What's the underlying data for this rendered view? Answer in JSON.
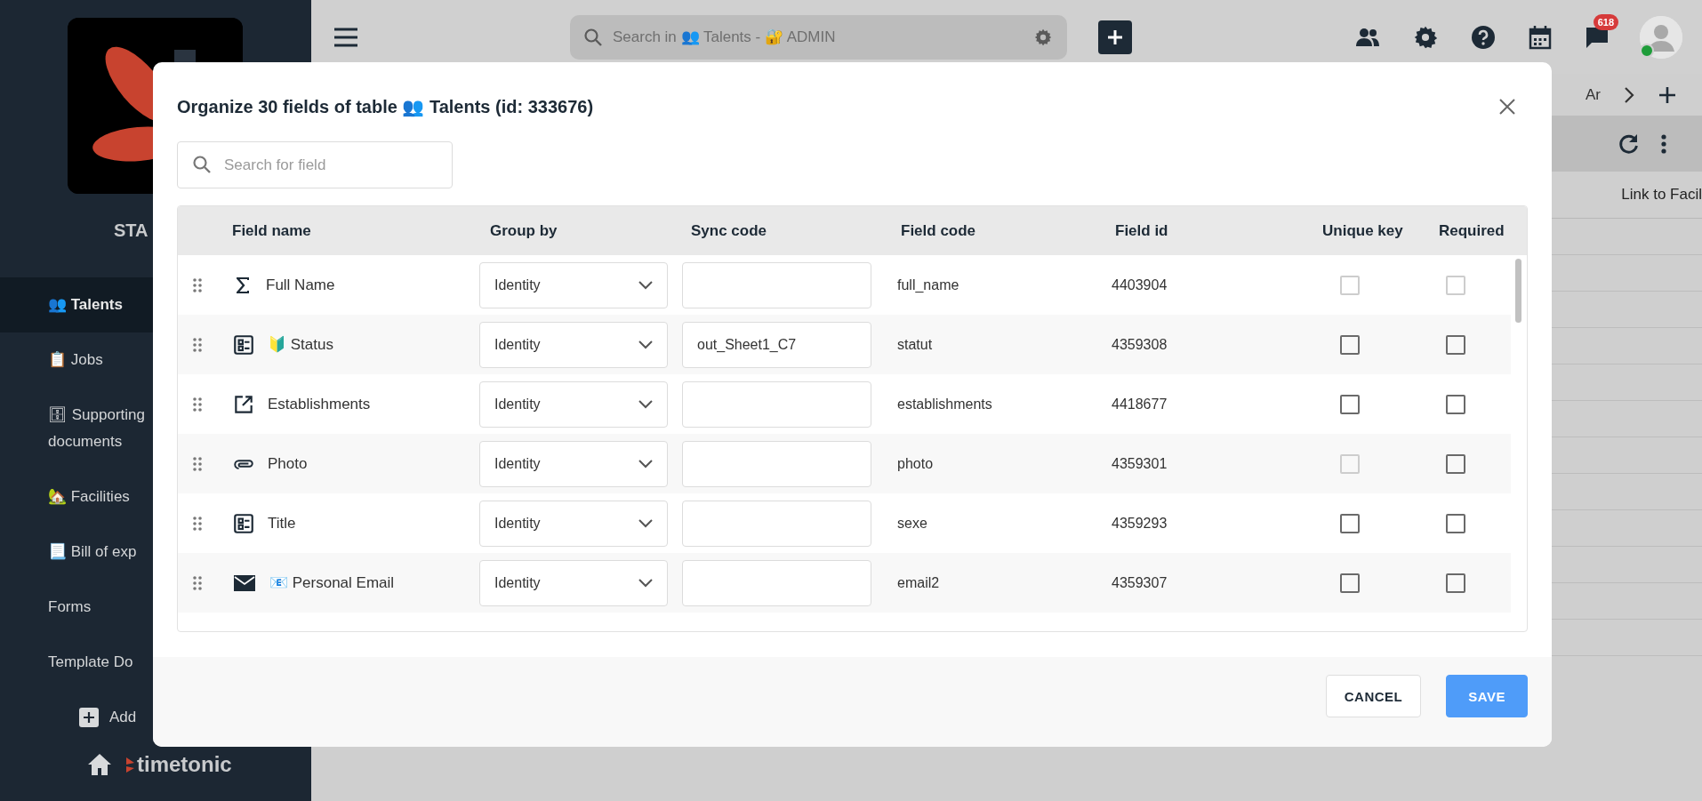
{
  "topbar": {
    "search_placeholder": "Search in 👥 Talents - 🔐 ADMIN",
    "notifications": "618",
    "user_online": true
  },
  "sidebar": {
    "workspace": "STA",
    "items": [
      {
        "label": "👥 Talents",
        "kind": "nav",
        "selected": true
      },
      {
        "label": "📋 Jobs",
        "kind": "nav",
        "selected": false
      },
      {
        "label": "🗄 Supporting documents",
        "kind": "nav",
        "selected": false
      },
      {
        "label": "🏡 Facilities",
        "kind": "nav",
        "selected": false
      },
      {
        "label": "📃 Bill of exp",
        "kind": "nav",
        "selected": false
      },
      {
        "label": "Forms",
        "kind": "nav",
        "selected": false
      },
      {
        "label": "Template Do",
        "kind": "nav",
        "selected": false
      },
      {
        "label": "Add",
        "kind": "add",
        "selected": false
      }
    ],
    "brand": "timetonic"
  },
  "background": {
    "tab": "Ar",
    "column": "Link to Facil"
  },
  "dialog": {
    "title": "Organize 30 fields of table 👥 Talents (id: 333676)",
    "search_placeholder": "Search for field",
    "columns": [
      "Field name",
      "Group by",
      "Sync code",
      "Field code",
      "Field id",
      "Unique key",
      "Required"
    ],
    "rows": [
      {
        "kind": "formula",
        "name": "Full Name",
        "group_by": "Identity",
        "field_code": "full_name",
        "field_id": "4403904",
        "unique_key_checked": false,
        "unique_key_disabled": true,
        "required_checked": false,
        "required_disabled": true
      },
      {
        "kind": "list",
        "name": "🔰 Status",
        "group_by": "Identity",
        "sync_code": "out_Sheet1_C7",
        "field_code": "statut",
        "field_id": "4359308",
        "unique_key_checked": false,
        "unique_key_disabled": false,
        "required_checked": false,
        "required_disabled": false
      },
      {
        "kind": "link",
        "name": "Establishments",
        "group_by": "Identity",
        "field_code": "establishments",
        "field_id": "4418677",
        "unique_key_checked": false,
        "unique_key_disabled": false,
        "required_checked": false,
        "required_disabled": false
      },
      {
        "kind": "attachment",
        "name": "Photo",
        "group_by": "Identity",
        "field_code": "photo",
        "field_id": "4359301",
        "unique_key_checked": false,
        "unique_key_disabled": true,
        "required_checked": false,
        "required_disabled": false
      },
      {
        "kind": "list",
        "name": "Title",
        "group_by": "Identity",
        "field_code": "sexe",
        "field_id": "4359293",
        "unique_key_checked": false,
        "unique_key_disabled": false,
        "required_checked": false,
        "required_disabled": false
      },
      {
        "kind": "email",
        "name": "📧 Personal Email",
        "group_by": "Identity",
        "field_code": "email2",
        "field_id": "4359307",
        "unique_key_checked": false,
        "unique_key_disabled": false,
        "required_checked": false,
        "required_disabled": false
      }
    ],
    "buttons": [
      {
        "label": "CANCEL",
        "kind": "secondary"
      },
      {
        "label": "SAVE",
        "kind": "primary"
      }
    ]
  }
}
